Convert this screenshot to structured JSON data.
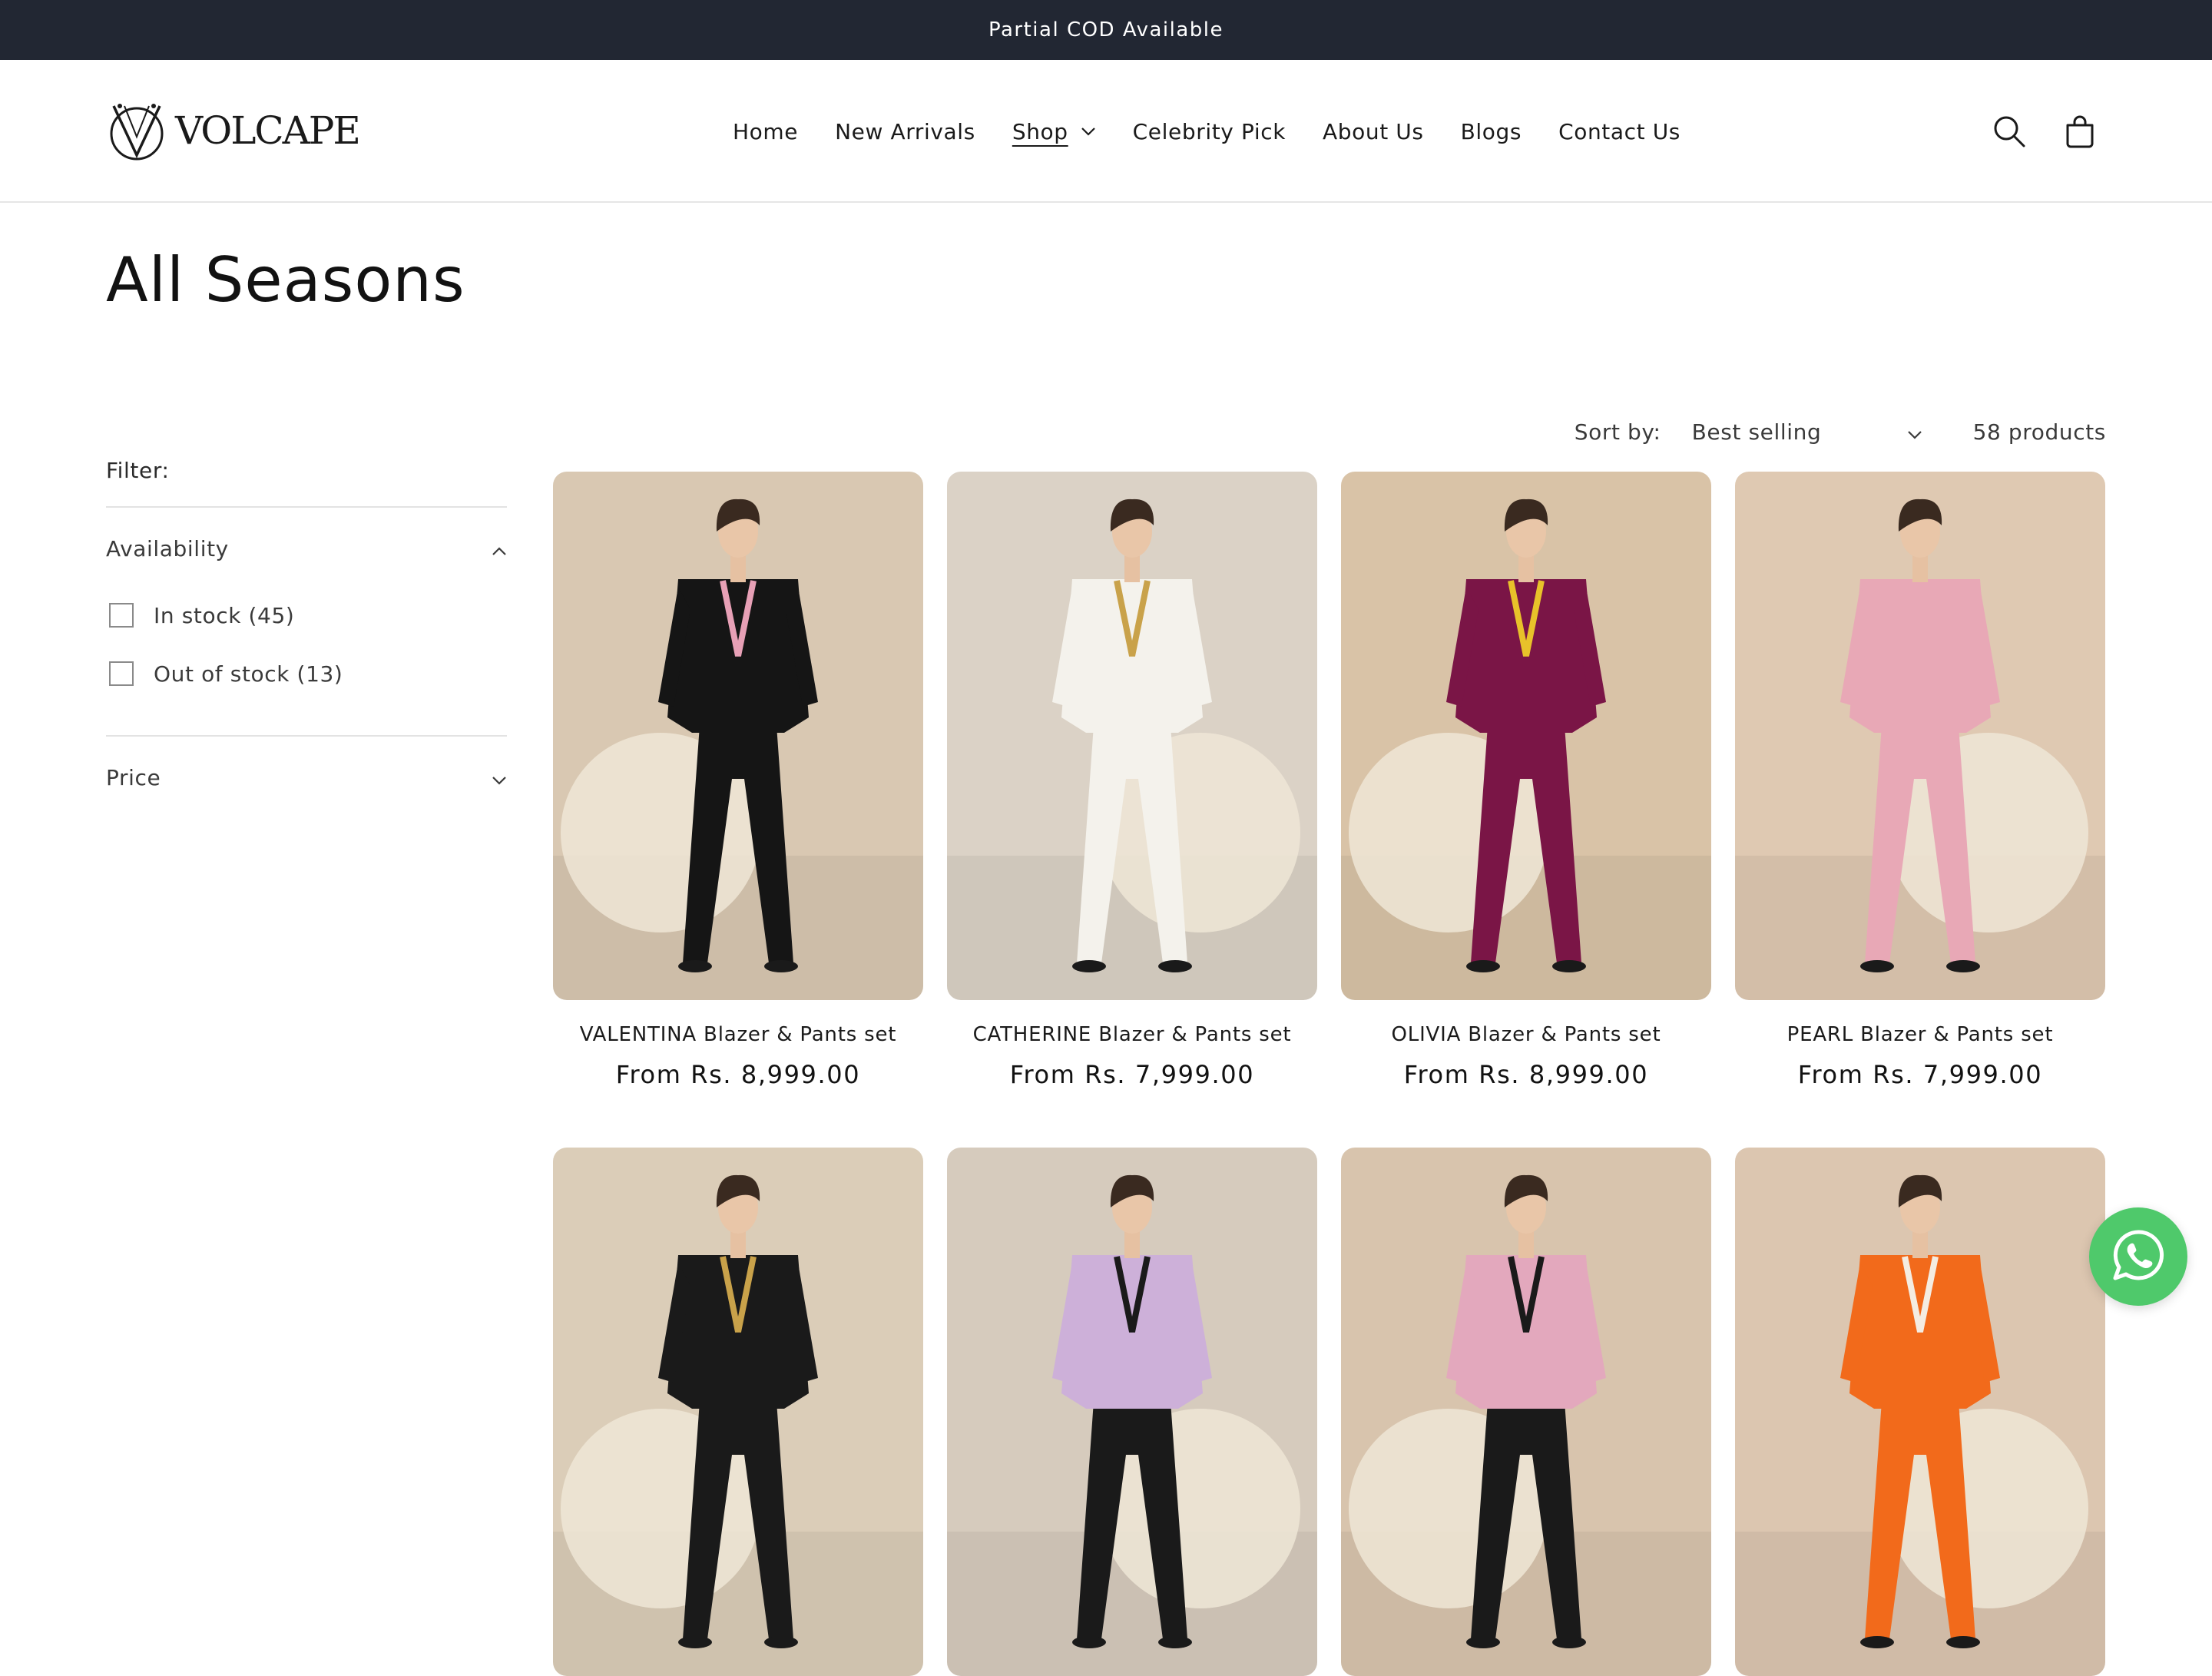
{
  "announcement": {
    "text": "Partial COD Available"
  },
  "header": {
    "logo_text": "VOLCAPE",
    "nav": [
      {
        "label": "Home"
      },
      {
        "label": "New Arrivals"
      },
      {
        "label": "Shop"
      },
      {
        "label": "Celebrity Pick"
      },
      {
        "label": "About Us"
      },
      {
        "label": "Blogs"
      },
      {
        "label": "Contact Us"
      }
    ],
    "icons": [
      "search-icon",
      "cart-icon"
    ]
  },
  "page": {
    "title": "All Seasons"
  },
  "filters": {
    "title": "Filter:",
    "availability": {
      "label": "Availability",
      "options": [
        {
          "label": "In stock (45)"
        },
        {
          "label": "Out of stock (13)"
        }
      ]
    },
    "price": {
      "label": "Price"
    }
  },
  "toolbar": {
    "sort_label": "Sort by:",
    "sort_value": "Best selling",
    "product_count": "58 products"
  },
  "products": [
    {
      "title": "VALENTINA Blazer & Pants set",
      "price": "From Rs. 8,999.00",
      "colors": {
        "bg": "#d9c8b2",
        "blazer": "#151515",
        "pants": "#151515",
        "accent": "#e7a0b6"
      }
    },
    {
      "title": "CATHERINE Blazer & Pants set",
      "price": "From Rs. 7,999.00",
      "colors": {
        "bg": "#dbd2c6",
        "blazer": "#f4f2ec",
        "pants": "#f4f2ec",
        "accent": "#c9a24a"
      }
    },
    {
      "title": "OLIVIA Blazer & Pants set",
      "price": "From Rs. 8,999.00",
      "colors": {
        "bg": "#d9c3a7",
        "blazer": "#7a1546",
        "pants": "#7a1546",
        "accent": "#e8c22a"
      }
    },
    {
      "title": "PEARL Blazer & Pants set",
      "price": "From Rs. 7,999.00",
      "colors": {
        "bg": "#dfc9b2",
        "blazer": "#e8a8b6",
        "pants": "#e8a8b6",
        "accent": "#e8a8b6"
      }
    },
    {
      "title": "",
      "price": "",
      "colors": {
        "bg": "#dbcdb8",
        "blazer": "#1a1a1a",
        "pants": "#1a1a1a",
        "accent": "#c9a24a"
      }
    },
    {
      "title": "",
      "price": "",
      "colors": {
        "bg": "#d6cbbd",
        "blazer": "#cdb0d9",
        "pants": "#1a1a1a",
        "accent": "#1a1a1a"
      }
    },
    {
      "title": "",
      "price": "",
      "colors": {
        "bg": "#d8c4ad",
        "blazer": "#e3a8bd",
        "pants": "#1a1a1a",
        "accent": "#1a1a1a"
      }
    },
    {
      "title": "",
      "price": "",
      "colors": {
        "bg": "#dcc6b0",
        "blazer": "#f26a1b",
        "pants": "#f26a1b",
        "accent": "#f4ece2"
      }
    }
  ],
  "colors": {
    "announcement_bg": "#222733",
    "whatsapp": "#4fc96b"
  }
}
